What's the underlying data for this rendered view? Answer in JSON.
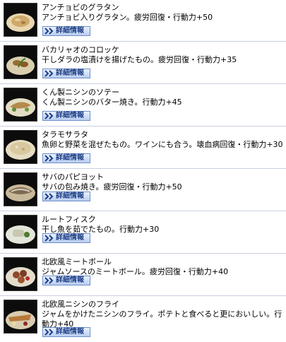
{
  "detail_label": "詳細情報",
  "items": [
    {
      "name": "アンチョビのグラタン",
      "description": "アンチョビ入りグラタン。疲労回復・行動力+50",
      "plate": "#e8d7b0",
      "food": "#cfa86a"
    },
    {
      "name": "バカリャオのコロッケ",
      "description": "干しダラの塩漬けを揚げたもの。疲労回復・行動力+35",
      "plate": "#d9cfae",
      "food": "#9a6b2e"
    },
    {
      "name": "くん製ニシンのソテー",
      "description": "くん製ニシンのバター焼き。行動力+45",
      "plate": "#e2dcc4",
      "food": "#b48a4c"
    },
    {
      "name": "タラモサラタ",
      "description": "魚卵と野菜を混ぜたもの。ワインにも合う。壊血病回復・行動力+30",
      "plate": "#e6dcc2",
      "food": "#d9c8a0"
    },
    {
      "name": "サバのパピヨット",
      "description": "サバの包み焼き。疲労回復・行動力+50",
      "plate": "#c8b89a",
      "food": "#7e6a52"
    },
    {
      "name": "ルートフィスク",
      "description": "干し魚を茹でたもの。行動力+30",
      "plate": "#e4e6da",
      "food": "#c9c7b2"
    },
    {
      "name": "北欧風ミートボール",
      "description": "ジャムソースのミートボール。疲労回復・行動力+40",
      "plate": "#e4dccb",
      "food": "#8e4a2a"
    },
    {
      "name": "北欧風ニシンのフライ",
      "description": "ジャムをかけたニシンのフライ。ポテトと食べると更においしい。行動力+40",
      "plate": "#d8ccb0",
      "food": "#b8793a"
    }
  ]
}
